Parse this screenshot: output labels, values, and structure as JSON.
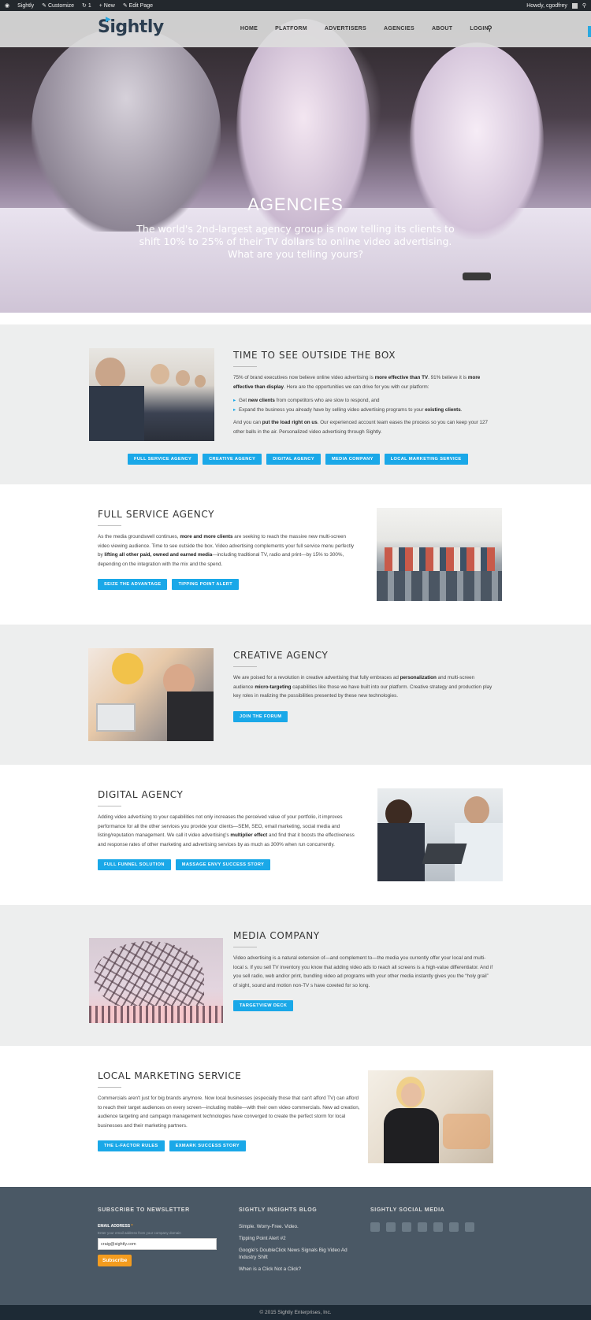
{
  "adminbar": {
    "site": "Sightly",
    "customize": "Customize",
    "updates": "1",
    "new": "+ New",
    "edit": "Edit Page",
    "howdy": "Howdy, cgodfrey"
  },
  "nav": {
    "logo": "Sightly",
    "items": [
      "HOME",
      "PLATFORM",
      "ADVERTISERS",
      "AGENCIES",
      "ABOUT",
      "LOGIN"
    ]
  },
  "hero": {
    "title": "AGENCIES",
    "subtitle": "The world's 2nd-largest agency group is now telling its clients to shift 10% to 25% of their TV dollars to online video advertising. What are you telling yours?"
  },
  "box": {
    "title": "TIME TO SEE OUTSIDE THE BOX",
    "p1_a": "75% of brand executives now believe online video advertising is ",
    "p1_b": "more effective than TV",
    "p1_c": ". 91% believe it is ",
    "p1_d": "more effective than display",
    "p1_e": ". Here are the opportunities we can drive for you with our platform:",
    "li1_a": "Get ",
    "li1_b": "new clients",
    "li1_c": " from competitors who are slow to respond, and",
    "li2_a": "Expand the business you already have by selling video advertising programs to your ",
    "li2_b": "existing clients",
    "li2_c": ".",
    "p2_a": "And you can ",
    "p2_b": "put the load right on us",
    "p2_c": ". Our experienced account team eases the process so you can keep your 127 other balls in the air. Personalized video advertising through Sightly.",
    "buttons": [
      "FULL SERVICE AGENCY",
      "CREATIVE AGENCY",
      "DIGITAL AGENCY",
      "MEDIA COMPANY",
      "LOCAL MARKETING SERVICE"
    ]
  },
  "full": {
    "title": "FULL SERVICE AGENCY",
    "t1": "As the media groundswell continues, ",
    "t2": "more and more clients",
    "t3": " are seeking to reach the massive new multi-screen video viewing audience. Time to see outside the box. Video advertising complements your full service menu perfectly by ",
    "t4": "lifting all other paid, owned and earned media",
    "t5": "—including traditional TV, radio and print—by 15% to 300%, depending on the integration with the mix and the spend.",
    "buttons": [
      "SEIZE THE ADVANTAGE",
      "TIPPING POINT ALERT"
    ]
  },
  "creative": {
    "title": "CREATIVE AGENCY",
    "t1": "We are poised for a revolution in creative advertising that fully embraces ad ",
    "t2": "personalization",
    "t3": " and multi-screen audience ",
    "t4": "micro-targeting",
    "t5": " capabilities like those we have built into our platform. Creative strategy and production play key roles in realizing the possibilities presented by these new technologies.",
    "buttons": [
      "JOIN THE FORUM"
    ]
  },
  "digital": {
    "title": "DIGITAL AGENCY",
    "t1": "Adding video advertising to your capabilities not only increases the perceived value of your portfolio, it improves performance for all the other services you provide your clients—SEM, SEO, email marketing, social media and listing/reputation management. We call it video advertising's ",
    "t2": "multiplier effect",
    "t3": " and find that it boosts the effectiveness and response rates of other marketing and advertising services by as much as 300% when run concurrently.",
    "buttons": [
      "FULL FUNNEL SOLUTION",
      "MASSAGE ENVY SUCCESS STORY"
    ]
  },
  "media": {
    "title": "MEDIA COMPANY",
    "text": "Video advertising is a natural extension of—and complement to—the media you currently offer your local and multi-local s. If you sell TV inventory you know that adding video ads to reach all screens is a high-value differentiator. And if you sell radio, web and/or print, bundling video ad programs with your other media instantly gives you the “holy grail” of sight, sound and motion non-TV s have coveted for so long.",
    "buttons": [
      "TARGETVIEW DECK"
    ]
  },
  "local": {
    "title": "LOCAL MARKETING SERVICE",
    "text": "Commercials aren't just for big brands anymore. Now local businesses (especially those that can't afford TV) can afford to reach their target audiences on every screen—including mobile—with their own video commercials. New ad creation, audience targeting and campaign management technologies have converged to create the perfect storm for local businesses and their marketing partners.",
    "buttons": [
      "THE L-FACTOR RULES",
      "EXMARK SUCCESS STORY"
    ]
  },
  "footer": {
    "newsletter_title": "SUBSCRIBE TO NEWSLETTER",
    "email_label": "EMAIL ADDRESS",
    "email_required": "*",
    "email_help": "Enter your email address from your company domain",
    "email_value": "craig@sightly.com",
    "subscribe": "Subscribe",
    "blog_title": "SIGHTLY INSIGHTS BLOG",
    "blog_links": [
      "Simple. Worry-Free. Video.",
      "Tipping Point Alert #2",
      "Google's DoubleClick News Signals Big Video Ad Industry Shift",
      "When is a Click Not a Click?"
    ],
    "social_title": "SIGHTLY SOCIAL MEDIA",
    "social_icons": [
      "youtube-icon",
      "linkedin-icon",
      "twitter-icon",
      "googleplus-icon",
      "facebook-icon",
      "rss-icon",
      "email-icon"
    ],
    "copyright": "© 2015 Sightly Enterprises, Inc."
  },
  "colors": {
    "accent": "#1aa8e8",
    "subscribe": "#f39c1f",
    "footer": "#4a5865"
  }
}
